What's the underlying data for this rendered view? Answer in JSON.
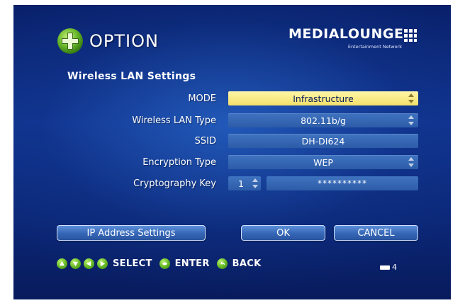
{
  "header": {
    "title": "OPTION",
    "title_icon": "dpad-icon"
  },
  "brand": {
    "name": "MEDIALOUNGE",
    "subtitle": "Entertainment Network",
    "logo_icon": "brand-grid-logo-icon"
  },
  "section": {
    "title": "Wireless LAN Settings"
  },
  "settings": {
    "mode": {
      "label": "MODE",
      "value": "Infrastructure"
    },
    "lan_type": {
      "label": "Wireless LAN Type",
      "value": "802.11b/g"
    },
    "ssid": {
      "label": "SSID",
      "value": "DH-DI624"
    },
    "encryption": {
      "label": "Encryption Type",
      "value": "WEP"
    },
    "crypto_key": {
      "label": "Cryptography Key",
      "index": "1",
      "value": "**********"
    }
  },
  "buttons": {
    "ip_settings": "IP Address Settings",
    "ok": "OK",
    "cancel": "CANCEL"
  },
  "footer": {
    "select_label": "SELECT",
    "enter_label": "ENTER",
    "back_label": "BACK",
    "page_number": "4",
    "page_icon": "page-tab-icon"
  },
  "colors": {
    "background": "#10338e",
    "field": "#3565b2",
    "active_field": "#f6e57a",
    "hint_button": "#62b624"
  }
}
